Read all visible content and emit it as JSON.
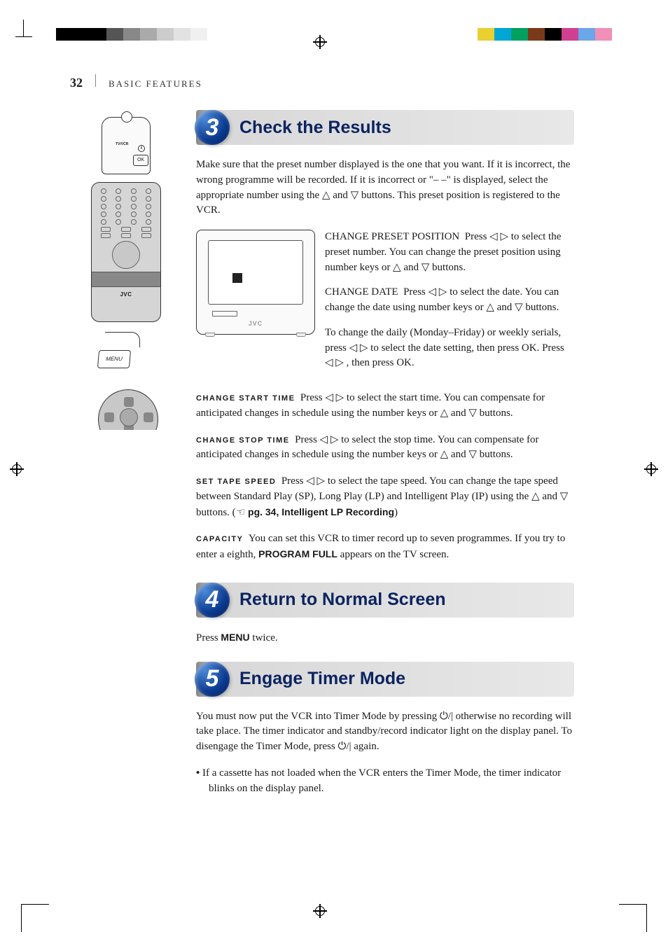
{
  "page_number": "32",
  "section_label": "BASIC FEATURES",
  "remote_labels": {
    "tvvcr": "TV/VCR",
    "ok": "OK",
    "i": "i",
    "logo": "JVC",
    "menu": "MENU"
  },
  "vcr_brand": "JVC",
  "steps": {
    "s3": {
      "num": "3",
      "title": "Check the Results",
      "intro": "Make sure that the preset number displayed is the one that you want. If it is incorrect, the wrong programme will be recorded. If it is incorrect or \"– –\" is displayed, select the appropriate number using the △ and ▽ buttons. This preset position is registered to the VCR.",
      "change_preset_label": "CHANGE PRESET POSITION",
      "change_preset_text": "Press ◁ ▷ to select the preset number. You can change the preset position using number keys or △ and ▽ buttons.",
      "change_date_label": "CHANGE DATE",
      "change_date_text": "Press ◁ ▷ to select the date. You can change the date using number keys or △ and ▽ buttons.",
      "daily": "To change the daily (Monday–Friday) or weekly serials, press ◁ ▷ to select the date setting, then press OK. Press ◁ ▷ , then press OK.",
      "change_start_label": "CHANGE START TIME",
      "change_start_text": "Press ◁ ▷ to select the start time. You can compensate for anticipated changes in schedule using the number keys or △ and ▽ buttons.",
      "change_stop_label": "CHANGE STOP TIME",
      "change_stop_text": "Press ◁ ▷ to select the stop time. You can compensate for anticipated changes in schedule using the number keys or △ and ▽ buttons.",
      "set_tape_label": "SET TAPE SPEED",
      "set_tape_text_a": "Press ◁ ▷ to select the tape speed. You can change the tape speed between Standard Play (SP), Long Play (LP) and Intelligent Play (IP) using the △ and ▽ buttons. (",
      "set_tape_ref": " pg. 34, Intelligent LP Recording",
      "set_tape_text_b": ")",
      "capacity_label": "CAPACITY",
      "capacity_text_a": "You can set this VCR to timer record up to seven programmes. If you try to enter a eighth, ",
      "capacity_bold": "PROGRAM FULL",
      "capacity_text_b": " appears on the TV screen."
    },
    "s4": {
      "num": "4",
      "title": "Return to Normal Screen",
      "text_a": "Press ",
      "menu": "MENU",
      "text_b": " twice."
    },
    "s5": {
      "num": "5",
      "title": "Engage Timer Mode",
      "text": "You must now put the VCR into Timer Mode by pressing ⏻/| otherwise no recording will take place. The timer indicator and standby/record indicator light on the display panel. To disengage the Timer Mode, press ⏻/| again.",
      "bullet": "If a cassette has not loaded when the VCR enters the Timer Mode, the timer indicator blinks on the display panel."
    }
  },
  "color_bars_left": [
    "#000",
    "#000",
    "#000",
    "#555",
    "#888",
    "#aaa",
    "#ccc",
    "#e2e2e2",
    "#f0f0f0"
  ],
  "color_bars_right": [
    "#e8d030",
    "#00a6d6",
    "#00a060",
    "#7a3a1a",
    "#000",
    "#d04090",
    "#6aa6e8",
    "#f090b8"
  ]
}
